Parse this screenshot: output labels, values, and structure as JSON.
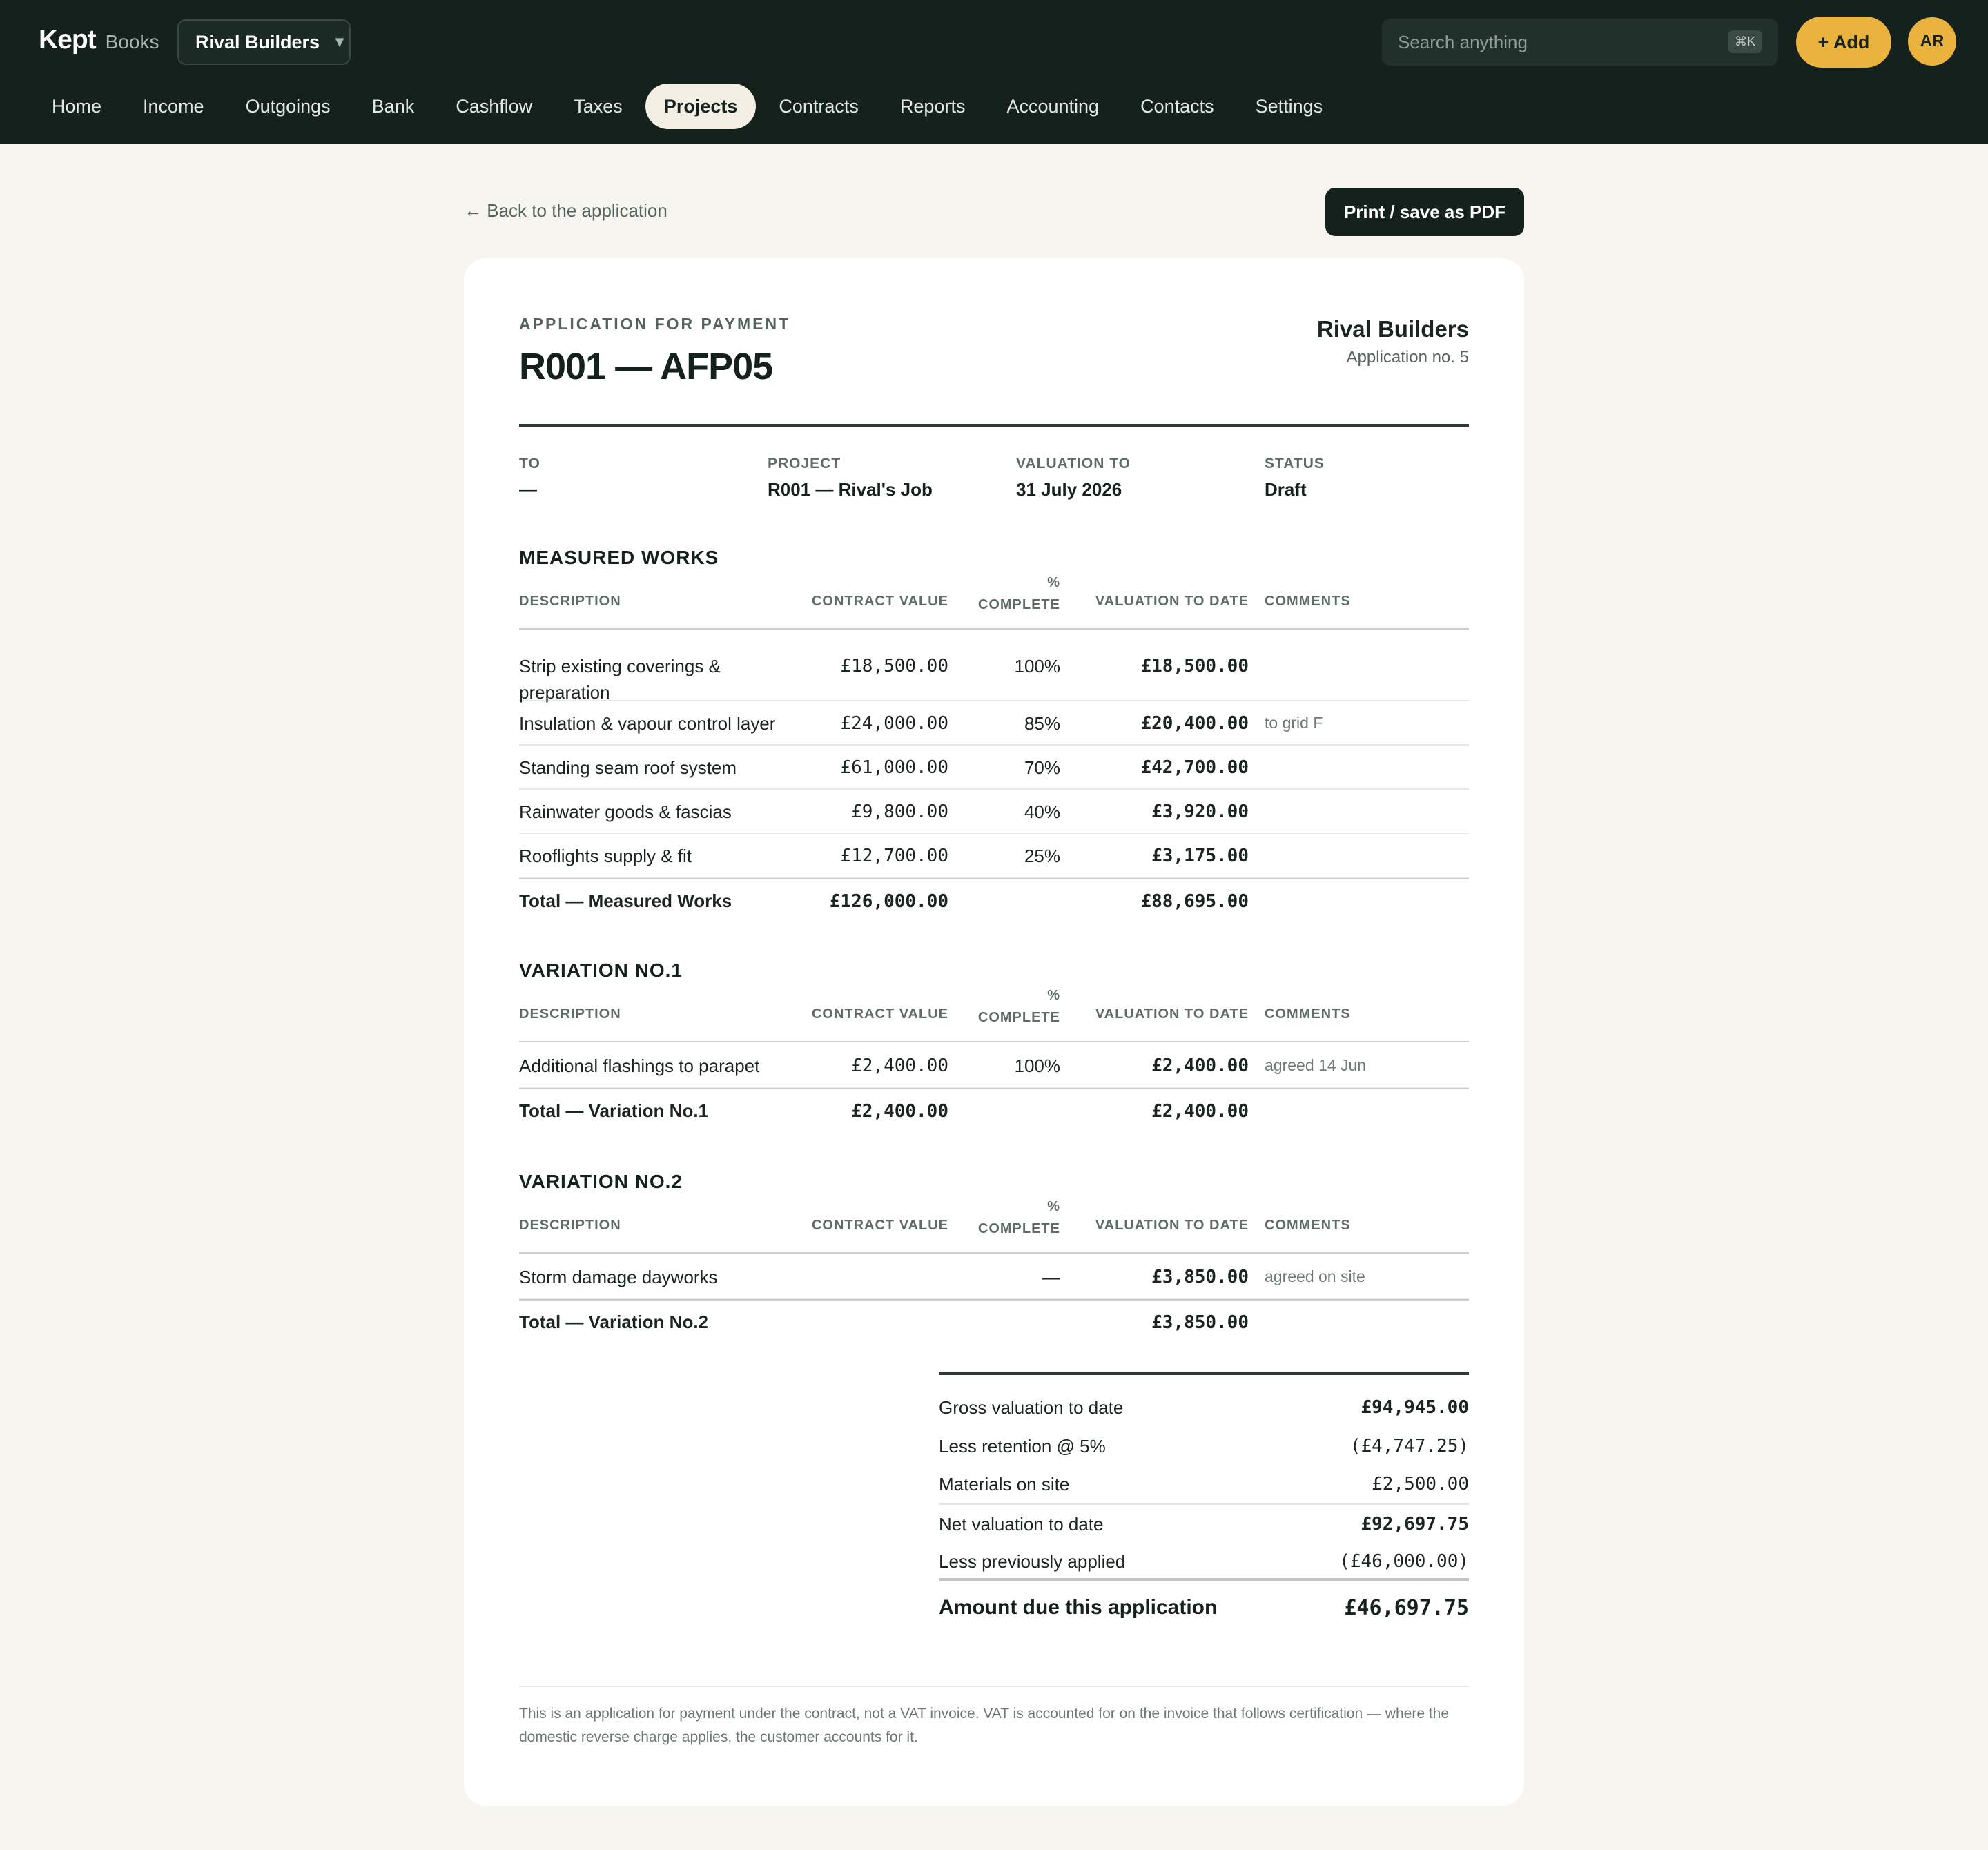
{
  "app": {
    "brand": "Kept",
    "brand_sub": "Books",
    "org": "Rival Builders",
    "search_placeholder": "Search anything",
    "search_shortcut": "⌘K",
    "add_label": "+ Add",
    "avatar": "AR"
  },
  "nav": [
    "Home",
    "Income",
    "Outgoings",
    "Bank",
    "Cashflow",
    "Taxes",
    "Projects",
    "Contracts",
    "Reports",
    "Accounting",
    "Contacts",
    "Settings"
  ],
  "nav_active": "Projects",
  "page": {
    "back_label": "← Back to the application",
    "print_label": "Print / save as PDF"
  },
  "doc": {
    "kicker": "APPLICATION FOR PAYMENT",
    "title": "R001 — AFP05",
    "company": "Rival Builders",
    "app_no": "Application no. 5",
    "meta": [
      {
        "label": "TO",
        "value": "—"
      },
      {
        "label": "PROJECT",
        "value": "R001 — Rival's Job"
      },
      {
        "label": "VALUATION TO",
        "value": "31 July 2026"
      },
      {
        "label": "STATUS",
        "value": "Draft"
      }
    ],
    "columns": {
      "description": "DESCRIPTION",
      "contract_value": "CONTRACT VALUE",
      "pct_symbol": "%",
      "pct_word": "COMPLETE",
      "valuation": "VALUATION TO DATE",
      "comments": "COMMENTS"
    },
    "sections": [
      {
        "title": "MEASURED WORKS",
        "rows": [
          {
            "desc": "Strip existing coverings & preparation",
            "cv": "£18,500.00",
            "pct": "100%",
            "val": "£18,500.00",
            "comment": ""
          },
          {
            "desc": "Insulation & vapour control layer",
            "cv": "£24,000.00",
            "pct": "85%",
            "val": "£20,400.00",
            "comment": "to grid F"
          },
          {
            "desc": "Standing seam roof system",
            "cv": "£61,000.00",
            "pct": "70%",
            "val": "£42,700.00",
            "comment": ""
          },
          {
            "desc": "Rainwater goods & fascias",
            "cv": "£9,800.00",
            "pct": "40%",
            "val": "£3,920.00",
            "comment": ""
          },
          {
            "desc": "Rooflights supply & fit",
            "cv": "£12,700.00",
            "pct": "25%",
            "val": "£3,175.00",
            "comment": ""
          }
        ],
        "total": {
          "label": "Total — Measured Works",
          "cv": "£126,000.00",
          "val": "£88,695.00"
        }
      },
      {
        "title": "VARIATION NO.1",
        "rows": [
          {
            "desc": "Additional flashings to parapet",
            "cv": "£2,400.00",
            "pct": "100%",
            "val": "£2,400.00",
            "comment": "agreed 14 Jun"
          }
        ],
        "total": {
          "label": "Total — Variation No.1",
          "cv": "£2,400.00",
          "val": "£2,400.00"
        }
      },
      {
        "title": "VARIATION NO.2",
        "rows": [
          {
            "desc": "Storm damage dayworks",
            "cv": "",
            "pct": "—",
            "val": "£3,850.00",
            "comment": "agreed on site"
          }
        ],
        "total": {
          "label": "Total — Variation No.2",
          "cv": "",
          "val": "£3,850.00"
        }
      }
    ],
    "summary": {
      "gross_label": "Gross valuation to date",
      "gross": "£94,945.00",
      "retention_label": "Less retention @ 5%",
      "retention": "(£4,747.25)",
      "materials_label": "Materials on site",
      "materials": "£2,500.00",
      "net_label": "Net valuation to date",
      "net": "£92,697.75",
      "previous_label": "Less previously applied",
      "previous": "(£46,000.00)",
      "due_label": "Amount due this application",
      "due": "£46,697.75"
    },
    "footnote": "This is an application for payment under the contract, not a VAT invoice. VAT is accounted for on the invoice that follows certification — where the domestic reverse charge applies, the customer accounts for it."
  },
  "colors": {
    "topbar": "#14211d",
    "accent": "#e9b33e",
    "page_bg": "#f6f5f0"
  }
}
